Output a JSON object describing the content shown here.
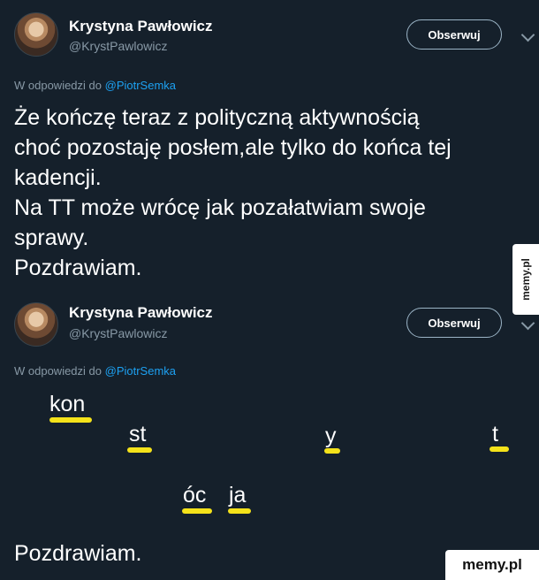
{
  "tweets": [
    {
      "author_name": "Krystyna Pawłowicz",
      "author_handle": "@KrystPawlowicz",
      "follow_label": "Obserwuj",
      "reply_prefix": "W odpowiedzi do",
      "reply_mention": "@PiotrSemka",
      "body": "Że kończę teraz z polityczną aktywnością\nchoć pozostaję posłem,ale tylko do końca tej\nkadencji.\nNa TT może wrócę jak pozałatwiam swoje\nsprawy.\nPozdrawiam."
    },
    {
      "author_name": "Krystyna Pawłowicz",
      "author_handle": "@KrystPawlowicz",
      "follow_label": "Obserwuj",
      "reply_prefix": "W odpowiedzi do",
      "reply_mention": "@PiotrSemka",
      "fragments": [
        "kon",
        "st",
        "y",
        "t",
        "óc",
        "ja"
      ],
      "signoff": "Pozdrawiam."
    }
  ],
  "watermarks": {
    "side": "memy.pl",
    "corner": "memy.pl"
  },
  "colors": {
    "background": "#15202b",
    "mention": "#1da1f2",
    "underline": "#f4e21a",
    "muted": "#8899a6"
  },
  "icons": [
    "avatar",
    "chevron-down-icon"
  ]
}
